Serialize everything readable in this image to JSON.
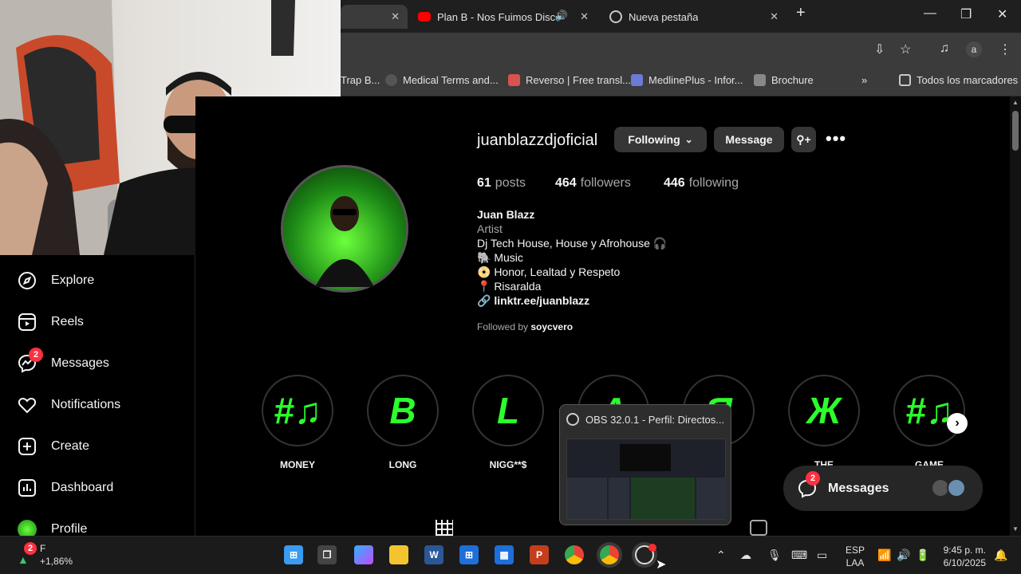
{
  "browser": {
    "tabs": [
      {
        "title": "",
        "active": true
      },
      {
        "title": "Plan B - Nos Fuimos Discote",
        "audio": true
      },
      {
        "title": "Nueva pestaña"
      }
    ],
    "profile_initial": "a",
    "bookmarks": [
      {
        "label": "Trap B..."
      },
      {
        "label": "Medical Terms and..."
      },
      {
        "label": "Reverso | Free transl..."
      },
      {
        "label": "MedlinePlus - Infor..."
      },
      {
        "label": "Brochure"
      }
    ],
    "all_bookmarks": "Todos los marcadores"
  },
  "sidebar": {
    "items": [
      {
        "label": "Explore",
        "icon": "compass-icon"
      },
      {
        "label": "Reels",
        "icon": "reels-icon"
      },
      {
        "label": "Messages",
        "icon": "messenger-icon",
        "badge": "2"
      },
      {
        "label": "Notifications",
        "icon": "heart-icon"
      },
      {
        "label": "Create",
        "icon": "plus-square-icon"
      },
      {
        "label": "Dashboard",
        "icon": "chart-icon"
      },
      {
        "label": "Profile",
        "icon": "avatar-icon"
      }
    ]
  },
  "profile": {
    "username": "juanblazzdjoficial",
    "following_btn": "Following",
    "message_btn": "Message",
    "posts_count": "61",
    "posts_label": "posts",
    "followers_count": "464",
    "followers_label": "followers",
    "following_count": "446",
    "following_label": "following",
    "name": "Juan Blazz",
    "category": "Artist",
    "bio": [
      "Dj Tech House, House y Afrohouse 🎧",
      "🐘 Music",
      "📀 Honor, Lealtad y Respeto",
      "📍 Risaralda"
    ],
    "link": "linktr.ee/juanblazz",
    "followed_by_prefix": "Followed by",
    "followed_by_user": "soycvero"
  },
  "highlights": [
    {
      "label": "MONEY",
      "glyph": "#♫"
    },
    {
      "label": "LONG",
      "glyph": "B"
    },
    {
      "label": "NIGG**$",
      "glyph": "L"
    },
    {
      "label": "",
      "glyph": "A"
    },
    {
      "label": "",
      "glyph": "Я"
    },
    {
      "label": "THE",
      "glyph": "Ж"
    },
    {
      "label": "GAME",
      "glyph": "#♫"
    }
  ],
  "messages_pill": {
    "label": "Messages",
    "badge": "2"
  },
  "obs_preview": {
    "title": "OBS 32.0.1 - Perfil: Directos..."
  },
  "taskbar": {
    "stock_badge": "2",
    "stock_label": "F",
    "stock_change": "+1,86%",
    "lang_top": "ESP",
    "lang_bottom": "LAA",
    "time": "9:45 p. m.",
    "date": "6/10/2025"
  },
  "colors": {
    "accent_green": "#2bff2b",
    "badge_red": "#ff3040",
    "panel": "#363636"
  }
}
